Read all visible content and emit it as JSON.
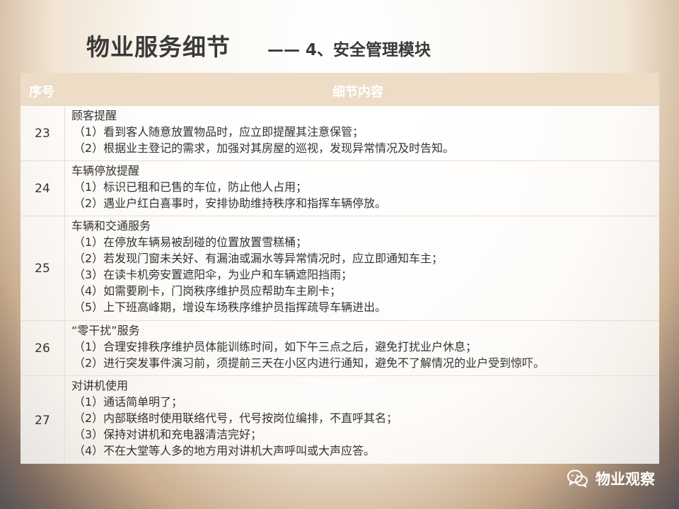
{
  "header": {
    "title": "物业服务细节",
    "subtitle": "—— 4、安全管理模块"
  },
  "table": {
    "columns": [
      "序号",
      "细节内容"
    ],
    "rows": [
      {
        "number": "23",
        "title": "顾客提醒",
        "items": [
          "（1）看到客人随意放置物品时，应立即提醒其注意保管；",
          "（2）根据业主登记的需求，加强对其房屋的巡视，发现异常情况及时告知。"
        ]
      },
      {
        "number": "24",
        "title": "车辆停放提醒",
        "items": [
          "（1）标识已租和已售的车位，防止他人占用；",
          "（2）遇业户红白喜事时，安排协助维持秩序和指挥车辆停放。"
        ]
      },
      {
        "number": "25",
        "title": "车辆和交通服务",
        "items": [
          "（1）在停放车辆易被刮碰的位置放置雪糕桶；",
          "（2）若发现门窗未关好、有漏油或漏水等异常情况时，应立即通知车主；",
          "（3）在读卡机旁安置遮阳伞，为业户和车辆遮阳挡雨；",
          "（4）如需要刷卡，门岗秩序维护员应帮助车主刷卡；",
          "（5）上下班高峰期，增设车场秩序维护员指挥疏导车辆进出。"
        ]
      },
      {
        "number": "26",
        "title": "“零干扰”服务",
        "items": [
          "（1）合理安排秩序维护员体能训练时间，如下午三点之后，避免打扰业户休息；",
          "（2）进行突发事件演习前，须提前三天在小区内进行通知，避免不了解情况的业户受到惊吓。"
        ]
      },
      {
        "number": "27",
        "title": "对讲机使用",
        "items": [
          "（1）通话简单明了；",
          "（2）内部联络时使用联络代号，代号按岗位编排，不直呼其名；",
          "（3）保持对讲机和充电器清洁完好；",
          "（4）不在大堂等人多的地方用对讲机大声呼叫或大声应答。"
        ]
      }
    ]
  },
  "brand": {
    "icon": "wechat-icon",
    "text": "物业观察"
  }
}
